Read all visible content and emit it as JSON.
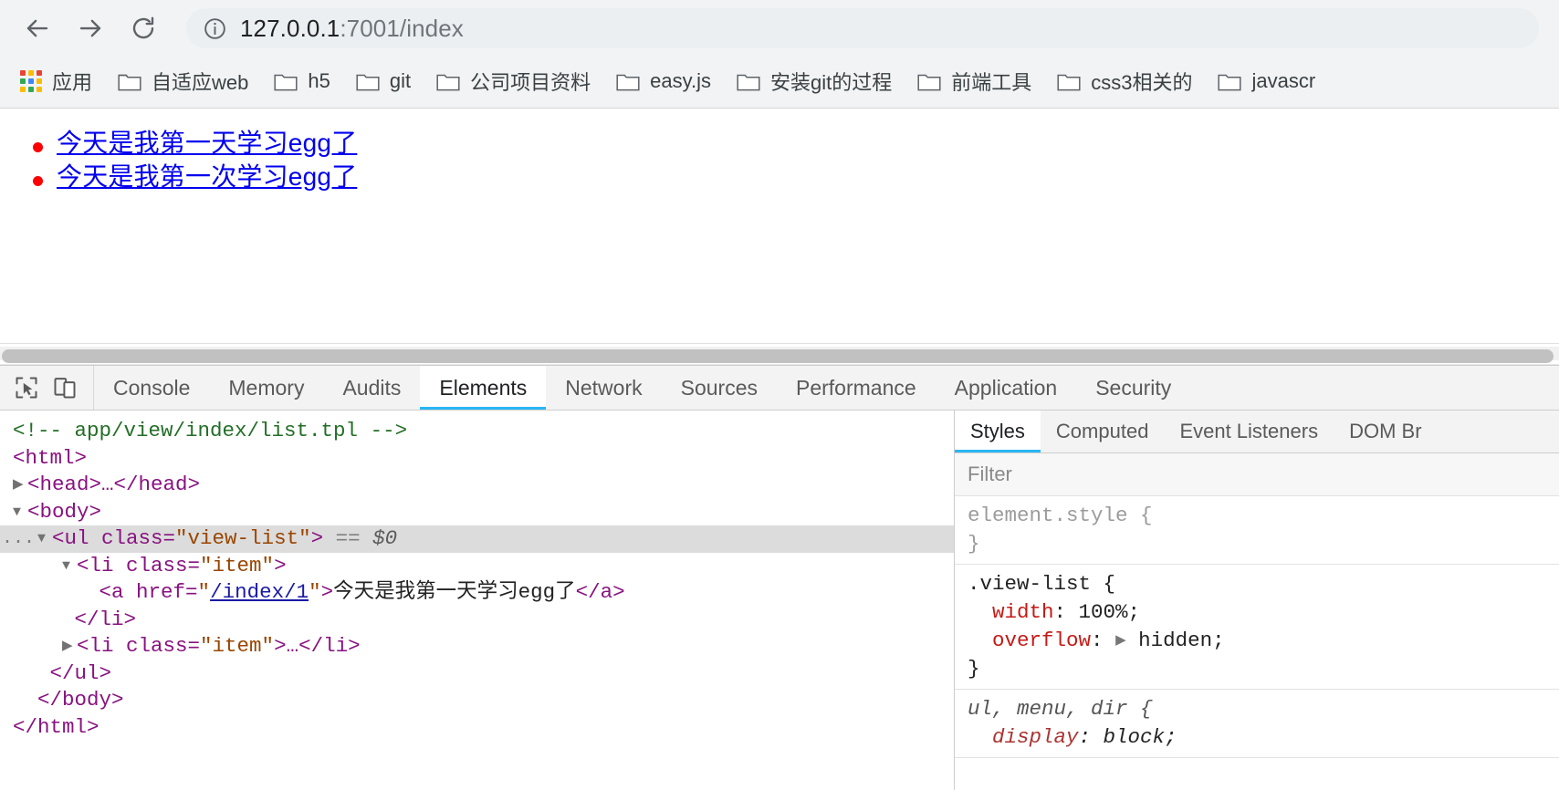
{
  "browser": {
    "nav": {
      "back_label": "Back",
      "forward_label": "Forward",
      "reload_label": "Reload"
    },
    "omnibox": {
      "info_icon": "info-circle-icon",
      "url_host": "127.0.0.1",
      "url_path": ":7001/index",
      "full_url": "127.0.0.1:7001/index"
    },
    "bookmarks": [
      {
        "label": "应用",
        "icon": "apps-grid-icon"
      },
      {
        "label": "自适应web",
        "icon": "folder-icon"
      },
      {
        "label": "h5",
        "icon": "folder-icon"
      },
      {
        "label": "git",
        "icon": "folder-icon"
      },
      {
        "label": "公司项目资料",
        "icon": "folder-icon"
      },
      {
        "label": "easy.js",
        "icon": "folder-icon"
      },
      {
        "label": "安装git的过程",
        "icon": "folder-icon"
      },
      {
        "label": "前端工具",
        "icon": "folder-icon"
      },
      {
        "label": "css3相关的",
        "icon": "folder-icon"
      },
      {
        "label": "javascr",
        "icon": "folder-icon"
      }
    ]
  },
  "page": {
    "list_items": [
      {
        "text": "今天是我第一天学习egg了",
        "href": "/index/1"
      },
      {
        "text": "今天是我第一次学习egg了",
        "href": "/index/2"
      }
    ],
    "link_color": "#0000ee",
    "bullet_color": "#ff0000"
  },
  "devtools": {
    "icons": {
      "inspect": "inspect-element-icon",
      "device": "device-toolbar-icon"
    },
    "tabs": [
      {
        "label": "Console",
        "active": false
      },
      {
        "label": "Memory",
        "active": false
      },
      {
        "label": "Audits",
        "active": false
      },
      {
        "label": "Elements",
        "active": true
      },
      {
        "label": "Network",
        "active": false
      },
      {
        "label": "Sources",
        "active": false
      },
      {
        "label": "Performance",
        "active": false
      },
      {
        "label": "Application",
        "active": false
      },
      {
        "label": "Security",
        "active": false
      }
    ],
    "accent_color": "#29b6f6",
    "dom": {
      "comment": "<!-- app/view/index/list.tpl -->",
      "l_html": "<html>",
      "l_head": "<head>…</head>",
      "l_body": "<body>",
      "ul_open_a": "<ul class=",
      "ul_class": "\"view-list\"",
      "ul_open_b": ">",
      "ul_eq": "==",
      "ul_dollar": "$0",
      "li_open_a": "<li class=",
      "li_class": "\"item\"",
      "li_open_b": ">",
      "a_open": "<a href=",
      "a_href": "/index/1",
      "a_open_end": ">",
      "a_text": "今天是我第一天学习egg了",
      "a_close": "</a>",
      "li_close": "</li>",
      "li_collapsed_a": "<li class=",
      "li_collapsed_class": "\"item\"",
      "li_collapsed_b": ">…</li>",
      "ul_close": "</ul>",
      "body_close": "</body>",
      "html_close": "</html>",
      "gutter_dots": "..."
    },
    "styles": {
      "tabs": [
        {
          "label": "Styles",
          "active": true
        },
        {
          "label": "Computed",
          "active": false
        },
        {
          "label": "Event Listeners",
          "active": false
        },
        {
          "label": "DOM Br",
          "active": false
        }
      ],
      "filter_placeholder": "Filter",
      "filter_value": "",
      "rules": [
        {
          "selector": "element.style {",
          "muted": true,
          "declarations": [],
          "close": "}"
        },
        {
          "selector": ".view-list {",
          "muted": false,
          "declarations": [
            {
              "name": "width",
              "value": "100%;",
              "expandable": false
            },
            {
              "name": "overflow",
              "value": "hidden;",
              "expandable": true
            }
          ],
          "close": "}"
        },
        {
          "selector": "ul, menu, dir {",
          "muted": false,
          "ua": true,
          "declarations": [
            {
              "name": "display",
              "value": "block;",
              "expandable": false
            }
          ],
          "close": "}"
        }
      ]
    }
  }
}
